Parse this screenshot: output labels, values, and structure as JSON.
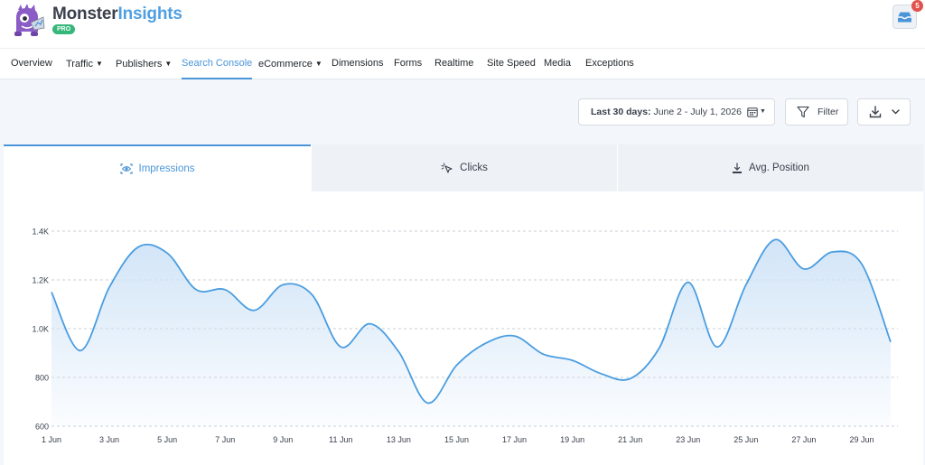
{
  "header": {
    "brand_part1": "Monster",
    "brand_part2": "Insights",
    "badge": "PRO",
    "notification_count": "5"
  },
  "nav": {
    "items": [
      {
        "label": "Overview",
        "dropdown": false
      },
      {
        "label": "Traffic",
        "dropdown": true
      },
      {
        "label": "Publishers",
        "dropdown": true
      },
      {
        "label": "Search Console",
        "dropdown": false,
        "active": true
      },
      {
        "label": "eCommerce",
        "dropdown": true
      },
      {
        "label": "Dimensions",
        "dropdown": false
      },
      {
        "label": "Forms",
        "dropdown": false
      },
      {
        "label": "Realtime",
        "dropdown": false
      },
      {
        "label": "Site Speed",
        "dropdown": false
      },
      {
        "label": "Media",
        "dropdown": false
      },
      {
        "label": "Exceptions",
        "dropdown": false
      }
    ]
  },
  "toolbar": {
    "date_prefix": "Last 30 days:",
    "date_range": " June 2 - July 1, 2026",
    "filter_label": "Filter"
  },
  "tabs": [
    {
      "label": "Impressions",
      "icon": "eye-icon",
      "active": true
    },
    {
      "label": "Clicks",
      "icon": "cursor-click-icon",
      "active": false
    },
    {
      "label": "Avg. Position",
      "icon": "position-icon",
      "active": false
    }
  ],
  "colors": {
    "accent": "#4a95d8",
    "line": "#4a9de0",
    "fill": "#cfe3f7",
    "badge_green": "#35b77a",
    "badge_red": "#e2524c"
  },
  "chart_data": {
    "type": "area",
    "x": [
      "1 Jun",
      "2 Jun",
      "3 Jun",
      "4 Jun",
      "5 Jun",
      "6 Jun",
      "7 Jun",
      "8 Jun",
      "9 Jun",
      "10 Jun",
      "11 Jun",
      "12 Jun",
      "13 Jun",
      "14 Jun",
      "15 Jun",
      "16 Jun",
      "17 Jun",
      "18 Jun",
      "19 Jun",
      "20 Jun",
      "21 Jun",
      "22 Jun",
      "23 Jun",
      "24 Jun",
      "25 Jun",
      "26 Jun",
      "27 Jun",
      "28 Jun",
      "29 Jun",
      "30 Jun"
    ],
    "tick_labels": [
      "1 Jun",
      "3 Jun",
      "5 Jun",
      "7 Jun",
      "9 Jun",
      "11 Jun",
      "13 Jun",
      "15 Jun",
      "17 Jun",
      "19 Jun",
      "21 Jun",
      "23 Jun",
      "25 Jun",
      "27 Jun",
      "29 Jun"
    ],
    "series": [
      {
        "values": [
          1150,
          910,
          1170,
          1335,
          1310,
          1160,
          1160,
          1075,
          1180,
          1140,
          925,
          1020,
          905,
          695,
          850,
          940,
          970,
          895,
          870,
          815,
          795,
          920,
          1190,
          925,
          1180,
          1365,
          1245,
          1315,
          1265,
          945
        ]
      }
    ],
    "ylim": [
      600,
      1400
    ],
    "y_ticks": [
      "600",
      "800",
      "1.0K",
      "1.2K",
      "1.4K"
    ],
    "grid": true
  }
}
